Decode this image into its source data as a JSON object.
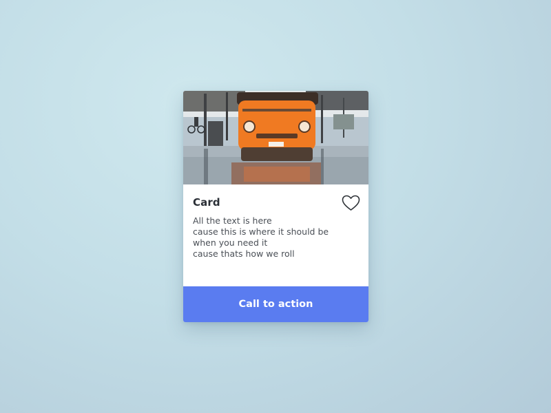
{
  "card": {
    "image_alt": "Orange van parked on a wet street",
    "title": "Card",
    "body_lines": [
      "All the text is here",
      "cause this is where it should be",
      "when you need it",
      "cause thats how we roll"
    ],
    "like_icon": "heart-outline-icon",
    "cta_label": "Call to action"
  },
  "colors": {
    "background": "#c3dee7",
    "card": "#ffffff",
    "accent": "#5a7cf0",
    "title_text": "#2a2f36",
    "body_text": "#4a4f56",
    "van": "#f07a22"
  }
}
